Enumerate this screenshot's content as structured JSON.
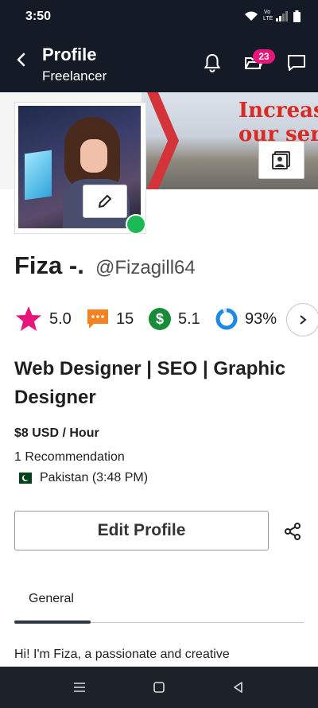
{
  "status_bar": {
    "time": "3:50",
    "network_label": "Vo LTE"
  },
  "app_bar": {
    "title": "Profile",
    "subtitle": "Freelancer",
    "inbox_badge": "23"
  },
  "cover": {
    "banner_text": "Increas our ser"
  },
  "profile": {
    "name": "Fiza -.",
    "username": "@Fizagill64",
    "headline": "Web Designer | SEO | Graphic Designer",
    "rate": "$8 USD / Hour",
    "recommendations": "1 Recommendation",
    "location": "Pakistan (3:48 PM)"
  },
  "stats": {
    "rating": "5.0",
    "reviews": "15",
    "earnings_score": "5.1",
    "completion": "93%"
  },
  "actions": {
    "edit_profile_label": "Edit Profile"
  },
  "tabs": [
    {
      "label": "General"
    }
  ],
  "about": {
    "intro": "Hi! I'm Fiza, a passionate and creative"
  },
  "colors": {
    "header_bg": "#151b26",
    "star": "#e8157a",
    "reviews": "#f58220",
    "earnings": "#1a8a3b",
    "completion": "#1e88e5",
    "online": "#1db954"
  },
  "icons": {
    "back": "arrow-left",
    "notifications": "bell",
    "inbox": "folder-open",
    "messages": "chat-bubble",
    "cover_edit": "portrait-frame",
    "avatar_edit": "pencil",
    "share": "share-nodes"
  }
}
